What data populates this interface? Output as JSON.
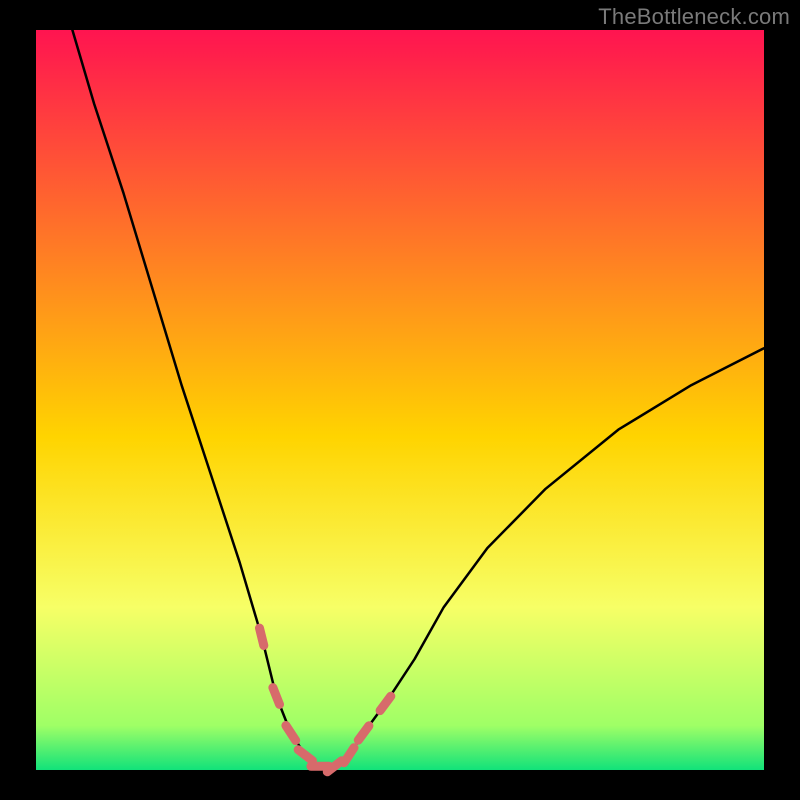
{
  "watermark": "TheBottleneck.com",
  "colors": {
    "bg": "#000000",
    "grad_top": "#ff1450",
    "grad_mid": "#ffd400",
    "grad_bot": "#11e27a",
    "curve": "#000000",
    "marker": "#d76a6b",
    "watermark": "#7a7a7a"
  },
  "chart_data": {
    "type": "line",
    "title": "",
    "xlabel": "",
    "ylabel": "",
    "xlim": [
      0,
      100
    ],
    "ylim": [
      0,
      100
    ],
    "series": [
      {
        "name": "bottleneck-curve",
        "x": [
          5,
          8,
          12,
          16,
          20,
          24,
          28,
          31,
          33,
          35,
          37,
          39,
          41,
          43,
          45,
          48,
          52,
          56,
          62,
          70,
          80,
          90,
          100
        ],
        "y": [
          100,
          90,
          78,
          65,
          52,
          40,
          28,
          18,
          10,
          5,
          2,
          0.5,
          0.5,
          2,
          5,
          9,
          15,
          22,
          30,
          38,
          46,
          52,
          57
        ]
      }
    ],
    "markers": {
      "name": "low-bottleneck-region",
      "x": [
        31,
        33,
        35,
        37,
        39,
        41,
        43,
        45,
        48
      ],
      "y": [
        18,
        10,
        5,
        2,
        0.5,
        0.5,
        2,
        5,
        9
      ]
    }
  }
}
